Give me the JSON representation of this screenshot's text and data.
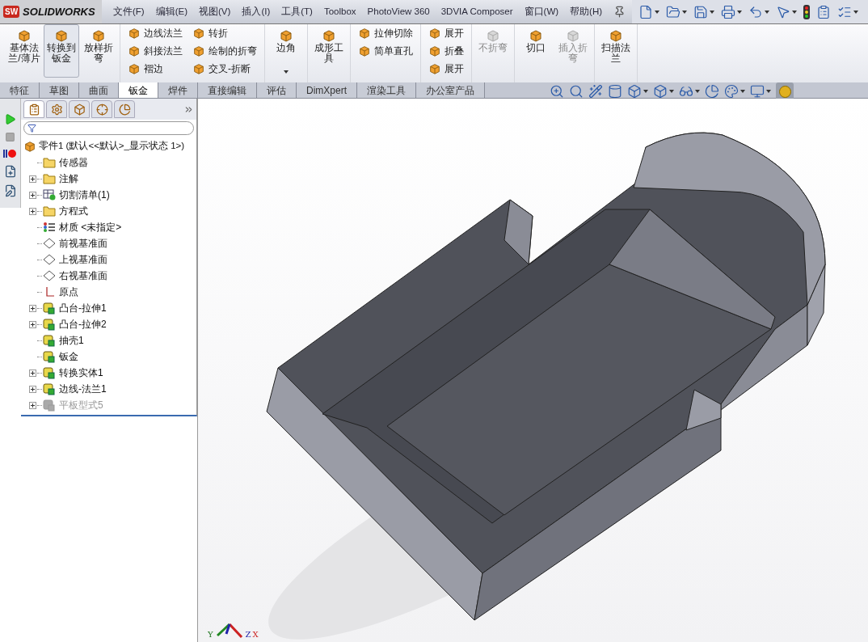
{
  "app": {
    "logo_badge": "SW",
    "logo_text": "SOLIDWORKS"
  },
  "menu": [
    "文件(F)",
    "编辑(E)",
    "视图(V)",
    "插入(I)",
    "工具(T)",
    "Toolbox",
    "PhotoView 360",
    "3DVIA Composer",
    "窗口(W)",
    "帮助(H)"
  ],
  "ribbon": {
    "groups": [
      [
        [
          {
            "kind": "large",
            "label": "基体法兰/薄片",
            "selected": false,
            "disabled": false
          }
        ],
        [
          {
            "kind": "large",
            "label": "转换到钣金",
            "selected": true,
            "disabled": false
          }
        ],
        [
          {
            "kind": "large",
            "label": "放样折弯",
            "selected": false,
            "disabled": false
          }
        ]
      ],
      [
        [
          {
            "kind": "small",
            "label": "边线法兰",
            "selected": false,
            "disabled": false
          },
          {
            "kind": "small",
            "label": "斜接法兰",
            "selected": false,
            "disabled": false
          },
          {
            "kind": "small",
            "label": "褶边",
            "selected": false,
            "disabled": false
          }
        ],
        [
          {
            "kind": "small",
            "label": "转折",
            "selected": false,
            "disabled": false
          },
          {
            "kind": "small",
            "label": "绘制的折弯",
            "selected": false,
            "disabled": false
          },
          {
            "kind": "small",
            "label": "交叉-折断",
            "selected": false,
            "disabled": false
          }
        ]
      ],
      [
        [
          {
            "kind": "menu",
            "label": "边角",
            "selected": false,
            "disabled": false
          }
        ]
      ],
      [
        [
          {
            "kind": "large",
            "label": "成形工具",
            "selected": false,
            "disabled": false
          }
        ]
      ],
      [
        [
          {
            "kind": "small",
            "label": "拉伸切除",
            "selected": false,
            "disabled": false
          },
          {
            "kind": "small",
            "label": "简单直孔",
            "selected": false,
            "disabled": false
          }
        ]
      ],
      [
        [
          {
            "kind": "small",
            "label": "展开",
            "selected": false,
            "disabled": false
          },
          {
            "kind": "small",
            "label": "折叠",
            "selected": false,
            "disabled": false
          },
          {
            "kind": "small",
            "label": "展开",
            "selected": false,
            "disabled": false
          }
        ]
      ],
      [
        [
          {
            "kind": "large",
            "label": "不折弯",
            "selected": false,
            "disabled": true
          }
        ]
      ],
      [
        [
          {
            "kind": "large",
            "label": "切口",
            "selected": false,
            "disabled": false
          }
        ],
        [
          {
            "kind": "large",
            "label": "插入折弯",
            "selected": false,
            "disabled": true
          }
        ]
      ],
      [
        [
          {
            "kind": "large",
            "label": "扫描法兰",
            "selected": false,
            "disabled": false
          }
        ]
      ]
    ]
  },
  "tabs": [
    {
      "label": "特征",
      "selected": false
    },
    {
      "label": "草图",
      "selected": false
    },
    {
      "label": "曲面",
      "selected": false
    },
    {
      "label": "钣金",
      "selected": true
    },
    {
      "label": "焊件",
      "selected": false
    },
    {
      "label": "直接编辑",
      "selected": false
    },
    {
      "label": "评估",
      "selected": false
    },
    {
      "label": "DimXpert",
      "selected": false
    },
    {
      "label": "渲染工具",
      "selected": false
    },
    {
      "label": "办公室产品",
      "selected": false
    }
  ],
  "feature_tree": {
    "panel_tabs": [
      {
        "selected": true
      },
      {
        "selected": false
      },
      {
        "selected": false
      },
      {
        "selected": false
      },
      {
        "selected": false
      }
    ],
    "root": {
      "label": "零件1 (默认<<默认>_显示状态 1>)",
      "children": [
        {
          "kind": "folder",
          "label": "传感器",
          "collapsible": false,
          "disabled": false
        },
        {
          "kind": "folder",
          "label": "注解",
          "collapsible": true,
          "disabled": false
        },
        {
          "kind": "cutlist",
          "label": "切割清单(1)",
          "collapsible": true,
          "disabled": false
        },
        {
          "kind": "folder",
          "label": "方程式",
          "collapsible": true,
          "disabled": false
        },
        {
          "kind": "material",
          "label": "材质 <未指定>",
          "collapsible": false,
          "disabled": false
        },
        {
          "kind": "plane",
          "label": "前视基准面",
          "collapsible": false,
          "disabled": false
        },
        {
          "kind": "plane",
          "label": "上视基准面",
          "collapsible": false,
          "disabled": false
        },
        {
          "kind": "plane",
          "label": "右视基准面",
          "collapsible": false,
          "disabled": false
        },
        {
          "kind": "origin",
          "label": "原点",
          "collapsible": false,
          "disabled": false
        },
        {
          "kind": "feature",
          "label": "凸台-拉伸1",
          "collapsible": true,
          "disabled": false
        },
        {
          "kind": "feature",
          "label": "凸台-拉伸2",
          "collapsible": true,
          "disabled": false
        },
        {
          "kind": "feature",
          "label": "抽壳1",
          "collapsible": false,
          "disabled": false
        },
        {
          "kind": "feature",
          "label": "钣金",
          "collapsible": false,
          "disabled": false
        },
        {
          "kind": "feature",
          "label": "转换实体1",
          "collapsible": true,
          "disabled": false
        },
        {
          "kind": "feature",
          "label": "边线-法兰1",
          "collapsible": true,
          "disabled": false
        },
        {
          "kind": "feature",
          "label": "平板型式5",
          "collapsible": true,
          "disabled": true
        }
      ]
    }
  },
  "viewport": {
    "axes": {
      "x": "X",
      "y": "Y",
      "z": "Z"
    }
  }
}
